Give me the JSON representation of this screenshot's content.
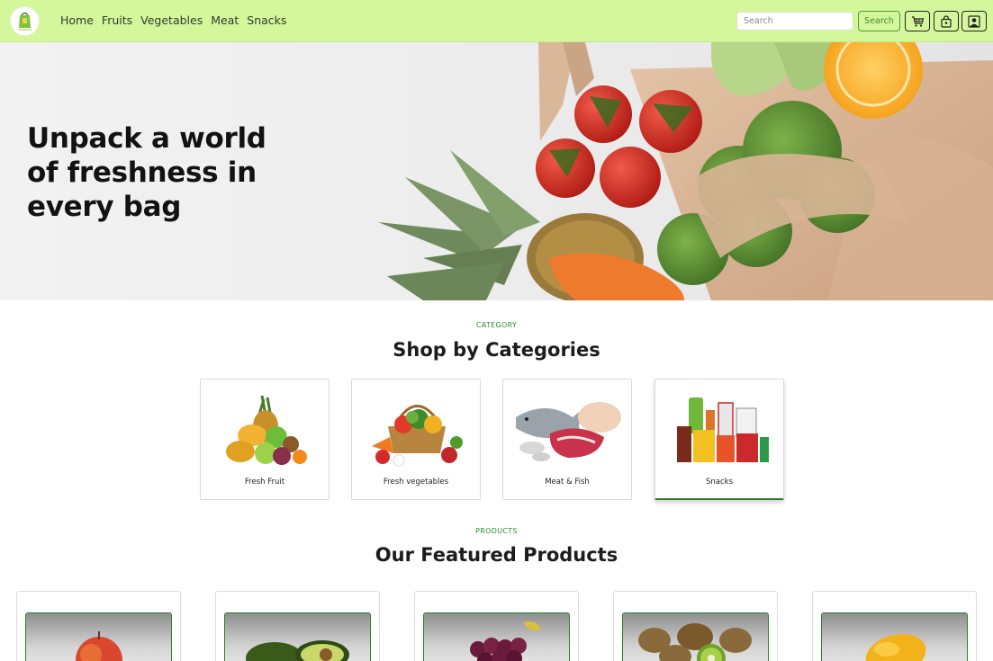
{
  "nav": {
    "links": [
      "Home",
      "Fruits",
      "Vegetables",
      "Meat",
      "Snacks"
    ],
    "search_placeholder": "Search",
    "search_button": "Search",
    "icons": [
      "cart-icon",
      "bag-icon",
      "user-icon"
    ]
  },
  "hero": {
    "title": "Unpack a world of freshness in every bag"
  },
  "categories": {
    "eyebrow": "CATEGORY",
    "title": "Shop by Categories",
    "items": [
      {
        "label": "Fresh Fruit"
      },
      {
        "label": "Fresh vegetables"
      },
      {
        "label": "Meat & Fish"
      },
      {
        "label": "Snacks"
      }
    ]
  },
  "products": {
    "eyebrow": "PRODUCTS",
    "title": "Our Featured Products",
    "items": [
      {
        "image": "apple"
      },
      {
        "image": "avocado"
      },
      {
        "image": "grapes"
      },
      {
        "image": "kiwi"
      },
      {
        "image": "mango"
      }
    ]
  },
  "colors": {
    "navbar_bg": "#d5f79c",
    "accent_green": "#2e7d32",
    "eyebrow_green": "#2e8b2e"
  }
}
